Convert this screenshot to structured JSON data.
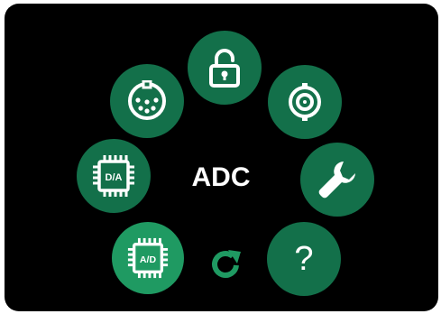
{
  "colors": {
    "background": "#000000",
    "button_fill": "#13704a",
    "button_fill_selected": "#1f9a62",
    "icon": "#ffffff",
    "accent_icon": "#1f9a62"
  },
  "center": {
    "label": "ADC"
  },
  "menu": {
    "items": [
      {
        "name": "lock",
        "icon": "lock-icon",
        "selected": false
      },
      {
        "name": "bnc",
        "icon": "bnc-connector-icon",
        "selected": false
      },
      {
        "name": "settings",
        "icon": "wrench-icon",
        "selected": false
      },
      {
        "name": "help",
        "icon": "question-icon",
        "label": "?",
        "selected": false
      },
      {
        "name": "refresh",
        "icon": "refresh-icon",
        "selected": false
      },
      {
        "name": "adc",
        "icon": "adc-chip-icon",
        "label": "A/D",
        "selected": true
      },
      {
        "name": "dac",
        "icon": "dac-chip-icon",
        "label": "D/A",
        "selected": false
      },
      {
        "name": "din",
        "icon": "din-connector-icon",
        "selected": false
      }
    ]
  }
}
